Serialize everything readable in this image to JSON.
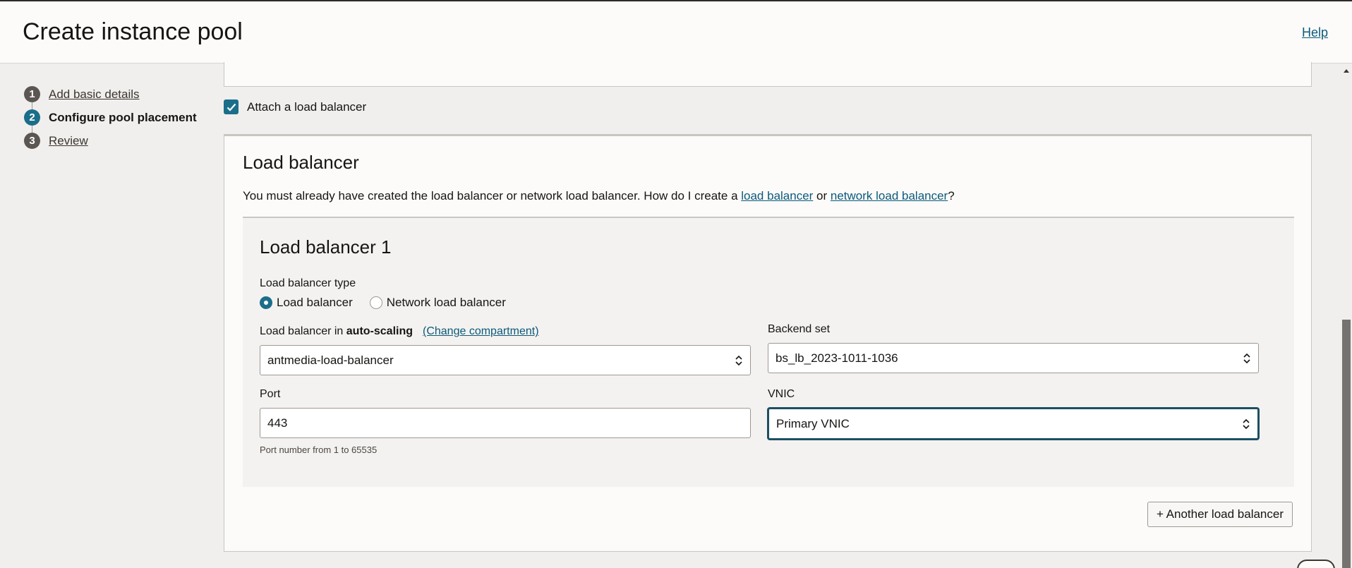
{
  "header": {
    "title": "Create instance pool",
    "help": "Help"
  },
  "steps": [
    {
      "num": "1",
      "label": "Add basic details",
      "active": false
    },
    {
      "num": "2",
      "label": "Configure pool placement",
      "active": true
    },
    {
      "num": "3",
      "label": "Review",
      "active": false
    }
  ],
  "attach": {
    "label": "Attach a load balancer",
    "checked": true
  },
  "section": {
    "title": "Load balancer",
    "desc_prefix": "You must already have created the load balancer or network load balancer. How do I create a ",
    "link_lb": "load balancer",
    "desc_or": " or ",
    "link_nlb": "network load balancer",
    "desc_suffix": "?"
  },
  "card": {
    "title": "Load balancer 1",
    "type_label": "Load balancer type",
    "radio_lb": "Load balancer",
    "radio_nlb": "Network load balancer",
    "selected_type": "Load balancer",
    "lb_label_prefix": "Load balancer in ",
    "lb_compartment": "auto-scaling",
    "change_compartment": "(Change compartment)",
    "lb_value": "antmedia-load-balancer",
    "backend_label": "Backend set",
    "backend_value": "bs_lb_2023-1011-1036",
    "port_label": "Port",
    "port_value": "443",
    "port_hint": "Port number from 1 to 65535",
    "vnic_label": "VNIC",
    "vnic_value": "Primary VNIC"
  },
  "another_button": "+ Another load balancer",
  "colors": {
    "accent": "#1a6e8a",
    "link": "#0b5a7a"
  }
}
